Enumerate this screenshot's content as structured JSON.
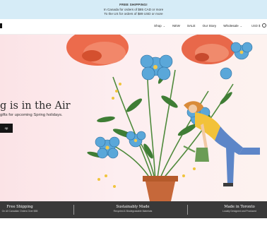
{
  "promo": {
    "title": "FREE SHIPPING!",
    "line_ca": "In Canada for orders of $85 CAD or more",
    "line_us": "To the US for orders of $89 USD or more"
  },
  "nav": {
    "items": [
      "Shop",
      "NEW",
      "SALE",
      "Our Story",
      "Wholesale"
    ],
    "currency": "USD $"
  },
  "hero": {
    "title": "g is in the Air",
    "subtitle": "gifts for upcoming Spring holidays.",
    "button": "op"
  },
  "features": [
    {
      "title": "Free Shipping",
      "subtitle": "On All Canadian Orders Over $85"
    },
    {
      "title": "Sustainably Made",
      "subtitle": "Recycled & Biodegradable Materials"
    },
    {
      "title": "Made in Toronto",
      "subtitle": "Locally Designed and Produced"
    }
  ],
  "colors": {
    "promo_bg": "#d6ecf7",
    "hero_bg": "#fbe3e6",
    "footer_bg": "#393939",
    "button_bg": "#141414"
  }
}
